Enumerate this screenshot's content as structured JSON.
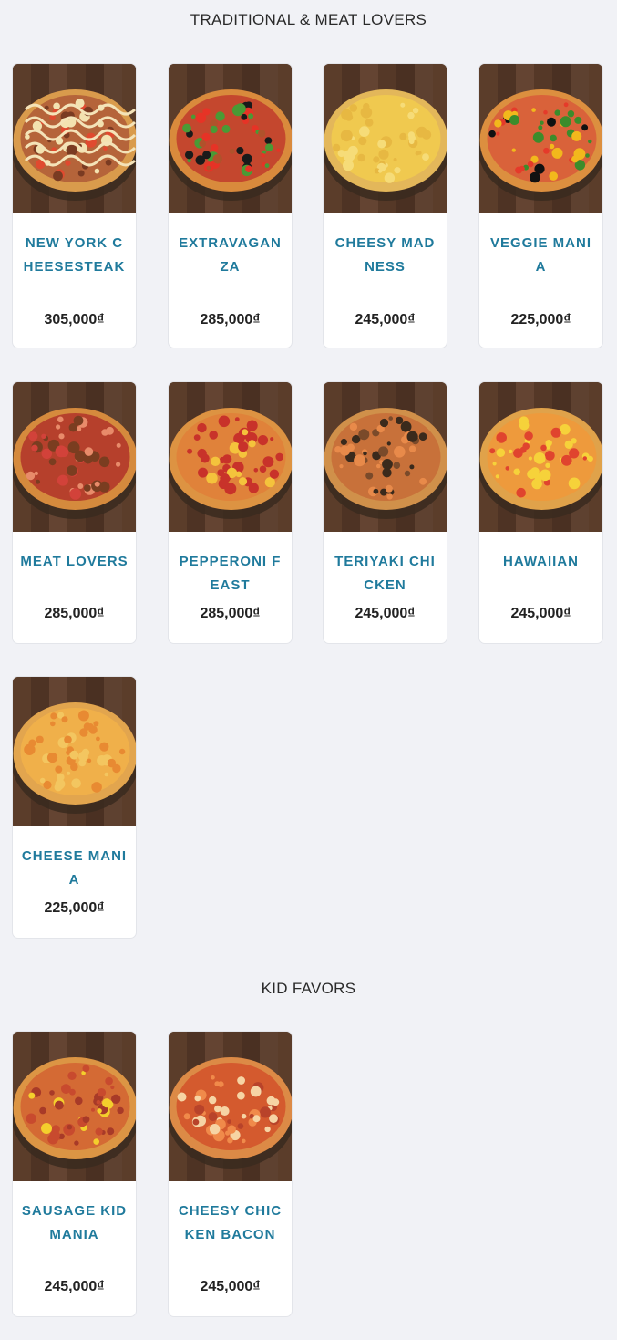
{
  "sections": [
    {
      "title": "TRADITIONAL & MEAT LOVERS",
      "items": [
        {
          "name": "NEW YORK CHEESESTEAK",
          "price": "305,000₫",
          "image": "pizza-new-york-cheesesteak"
        },
        {
          "name": "EXTRAVAGANZA",
          "price": "285,000₫",
          "image": "pizza-extravaganza"
        },
        {
          "name": "CHEESY MADNESS",
          "price": "245,000₫",
          "image": "pizza-cheesy-madness"
        },
        {
          "name": "VEGGIE MANIA",
          "price": "225,000₫",
          "image": "pizza-veggie-mania"
        },
        {
          "name": "MEAT LOVERS",
          "price": "285,000₫",
          "image": "pizza-meat-lovers"
        },
        {
          "name": "PEPPERONI FEAST",
          "price": "285,000₫",
          "image": "pizza-pepperoni-feast"
        },
        {
          "name": "TERIYAKI CHICKEN",
          "price": "245,000₫",
          "image": "pizza-teriyaki-chicken"
        },
        {
          "name": "HAWAIIAN",
          "price": "245,000₫",
          "image": "pizza-hawaiian"
        },
        {
          "name": "CHEESE MANIA",
          "price": "225,000₫",
          "image": "pizza-cheese-mania"
        }
      ]
    },
    {
      "title": "KID FAVORS",
      "items": [
        {
          "name": "SAUSAGE KID MANIA",
          "price": "245,000₫",
          "image": "pizza-sausage-kid-mania"
        },
        {
          "name": "CHEESY CHICKEN BACON",
          "price": "245,000₫",
          "image": "pizza-cheesy-chicken-bacon"
        }
      ]
    }
  ],
  "colors": {
    "background": "#f1f2f6",
    "item_name": "#1f7a9c",
    "price": "#222222",
    "wood": "#5a3d2b"
  }
}
